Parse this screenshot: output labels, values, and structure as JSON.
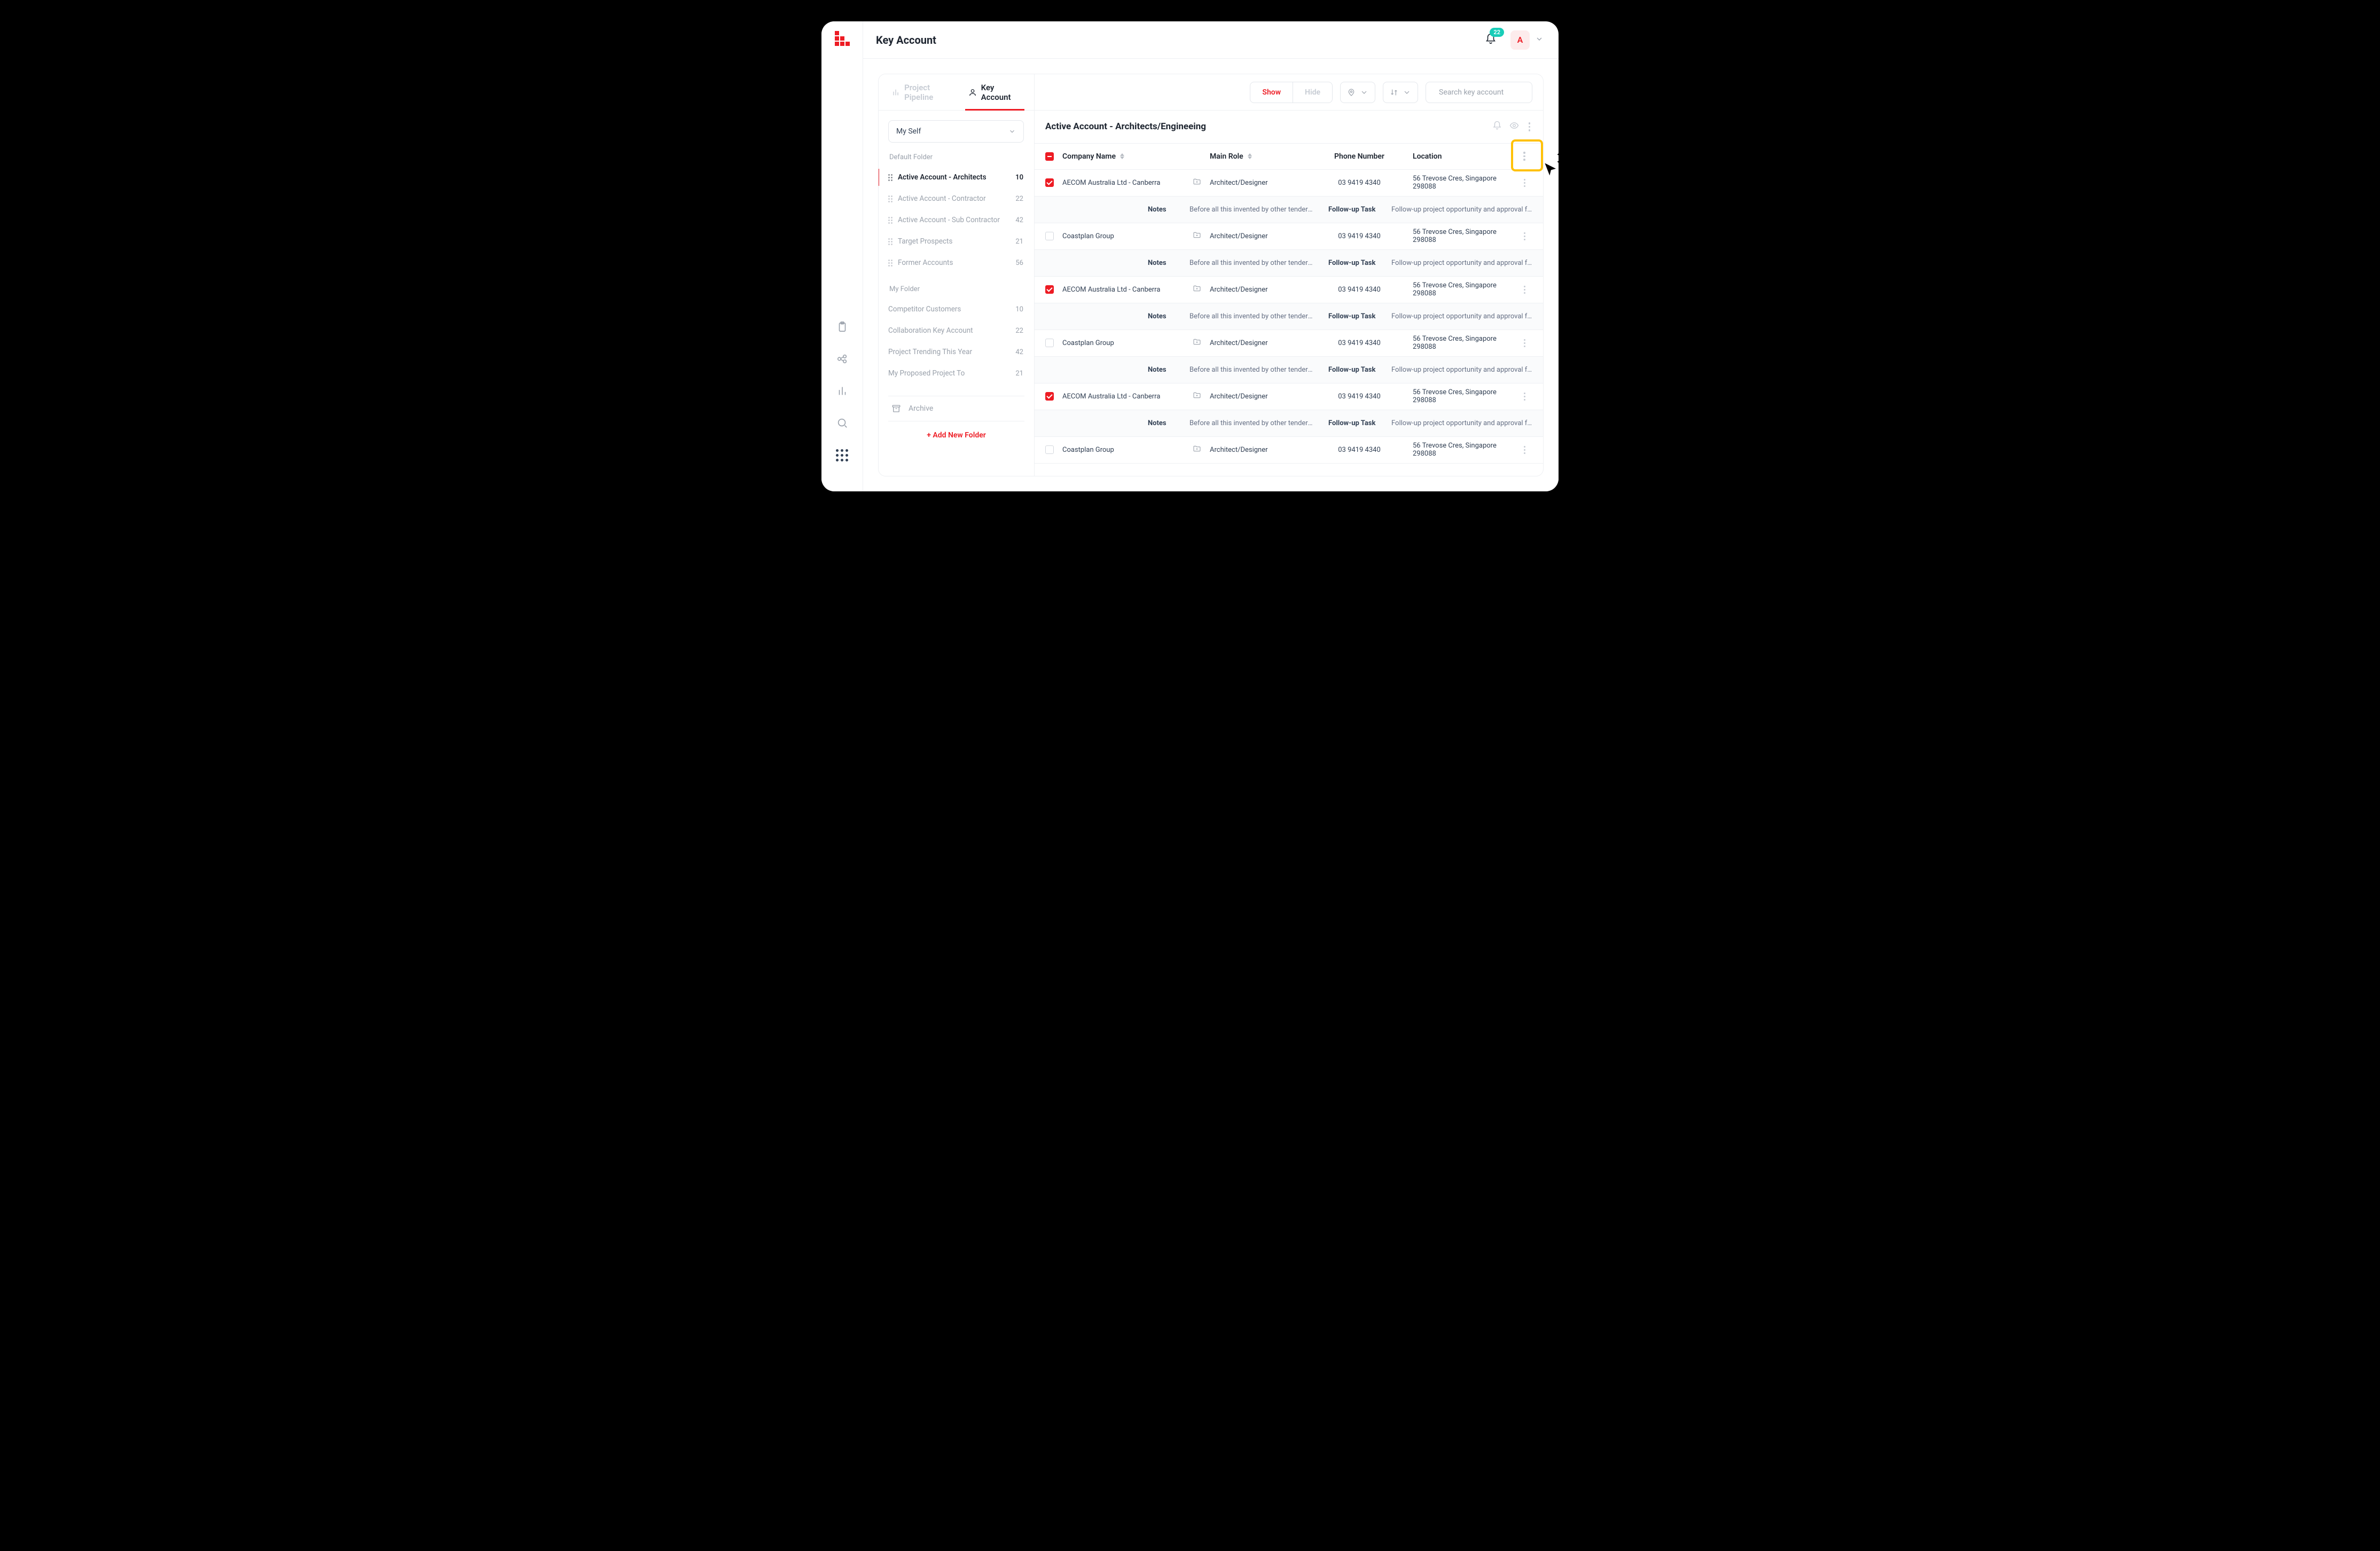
{
  "header": {
    "title": "Key Account",
    "notification_count": "22",
    "avatar_letter": "A"
  },
  "tabs": {
    "pipeline": "Project Pipeline",
    "key_account": "Key Account"
  },
  "sidebar": {
    "user_filter": "My Self",
    "default_folder_label": "Default Folder",
    "default_folders": [
      {
        "name": "Active Account - Architects",
        "count": "10",
        "active": true
      },
      {
        "name": "Active Account - Contractor",
        "count": "22",
        "active": false
      },
      {
        "name": "Active Account - Sub Contractor",
        "count": "42",
        "active": false
      },
      {
        "name": "Target Prospects",
        "count": "21",
        "active": false
      },
      {
        "name": "Former Accounts",
        "count": "56",
        "active": false
      }
    ],
    "my_folder_label": "My Folder",
    "my_folders": [
      {
        "name": "Competitor Customers",
        "count": "10"
      },
      {
        "name": "Collaboration Key Account",
        "count": "22"
      },
      {
        "name": "Project Trending This Year",
        "count": "42"
      },
      {
        "name": "My Proposed Project To",
        "count": "21"
      }
    ],
    "archive_label": "Archive",
    "add_folder_label": "+ Add New Folder"
  },
  "toolbar": {
    "show_label": "Show",
    "hide_label": "Hide",
    "search_placeholder": "Search key account"
  },
  "section": {
    "title": "Active Account - Architects/Engineeing"
  },
  "table": {
    "headers": {
      "company": "Company Name",
      "role": "Main Role",
      "phone": "Phone Number",
      "location": "Location"
    },
    "notes_label": "Notes",
    "followup_label": "Follow-up Task",
    "rows": [
      {
        "company": "AECOM Australia  Ltd - Canberra",
        "role": "Architect/Designer",
        "phone": "03 9419 4340",
        "location": "56 Trevose Cres, Singapore 298088",
        "checked": true,
        "notes": "Before all this invented by other tender we ne...",
        "followup": "Follow-up project opportunity and approval fr..."
      },
      {
        "company": "Coastplan Group",
        "role": "Architect/Designer",
        "phone": "03 9419 4340",
        "location": "56 Trevose Cres, Singapore 298088",
        "checked": false,
        "notes": "Before all this invented by other tender we ne...",
        "followup": "Follow-up project opportunity and approval fr..."
      },
      {
        "company": "AECOM Australia  Ltd - Canberra",
        "role": "Architect/Designer",
        "phone": "03 9419 4340",
        "location": "56 Trevose Cres, Singapore 298088",
        "checked": true,
        "notes": "Before all this invented by other tender we ne...",
        "followup": "Follow-up project opportunity and approval fr..."
      },
      {
        "company": "Coastplan Group",
        "role": "Architect/Designer",
        "phone": "03 9419 4340",
        "location": "56 Trevose Cres, Singapore 298088",
        "checked": false,
        "notes": "Before all this invented by other tender we ne...",
        "followup": "Follow-up project opportunity and approval fr..."
      },
      {
        "company": "AECOM Australia  Ltd - Canberra",
        "role": "Architect/Designer",
        "phone": "03 9419 4340",
        "location": "56 Trevose Cres, Singapore 298088",
        "checked": true,
        "notes": "Before all this invented by other tender we ne...",
        "followup": "Follow-up project opportunity and approval fr..."
      },
      {
        "company": "Coastplan Group",
        "role": "Architect/Designer",
        "phone": "03 9419 4340",
        "location": "56 Trevose Cres, Singapore 298088",
        "checked": false,
        "notes": "",
        "followup": ""
      }
    ]
  }
}
